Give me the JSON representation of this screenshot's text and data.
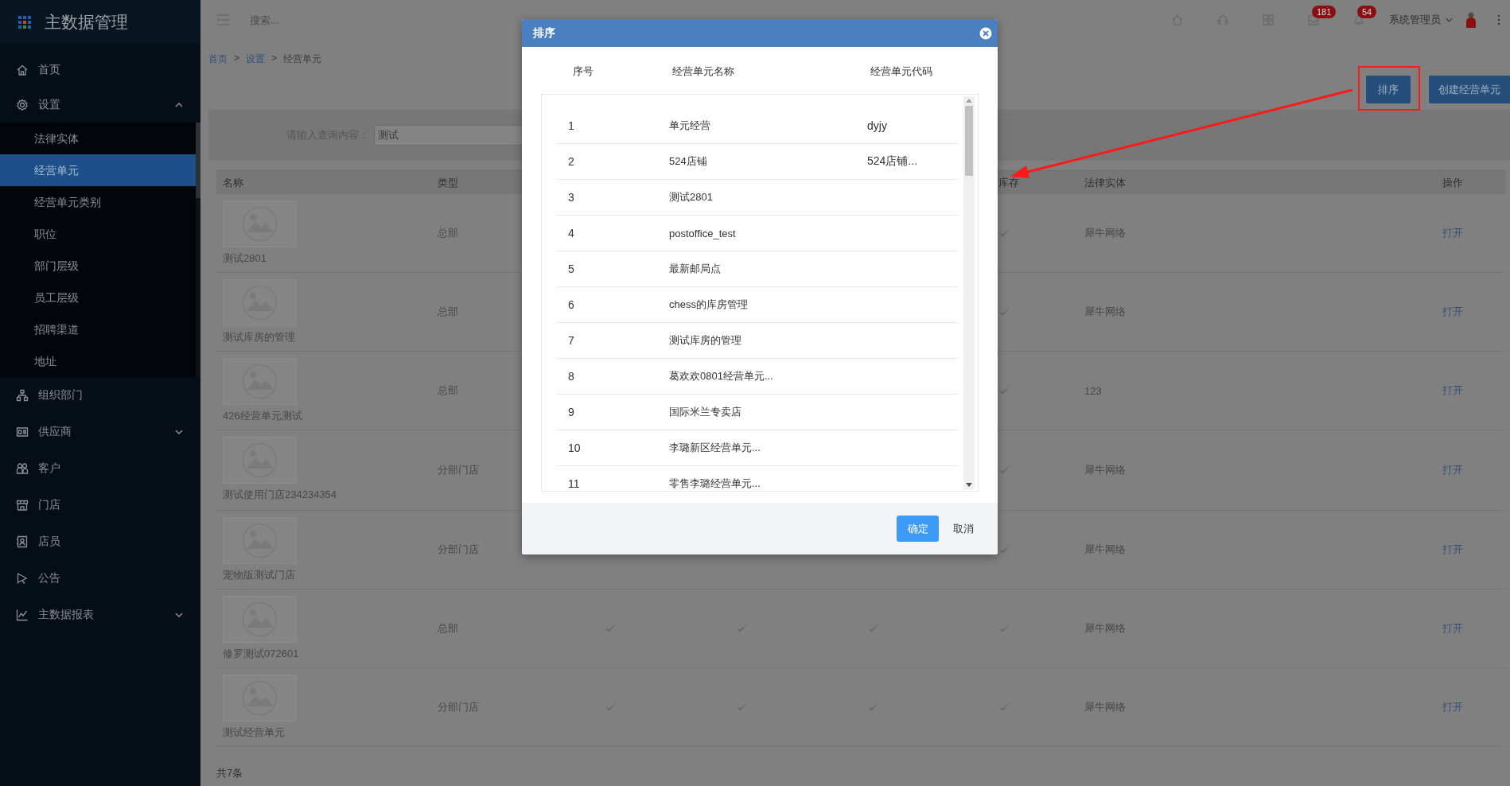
{
  "sidebar": {
    "title": "主数据管理",
    "items": [
      {
        "label": "首页"
      },
      {
        "label": "设置",
        "expanded": true,
        "children": [
          {
            "label": "法律实体",
            "selected": false
          },
          {
            "label": "经营单元",
            "selected": true
          },
          {
            "label": "经营单元类别",
            "selected": false
          },
          {
            "label": "职位",
            "selected": false
          },
          {
            "label": "部门层级",
            "selected": false
          },
          {
            "label": "员工层级",
            "selected": false
          },
          {
            "label": "招聘渠道",
            "selected": false
          },
          {
            "label": "地址",
            "selected": false
          }
        ]
      },
      {
        "label": "组织部门"
      },
      {
        "label": "供应商",
        "expanded": false
      },
      {
        "label": "客户"
      },
      {
        "label": "门店"
      },
      {
        "label": "店员"
      },
      {
        "label": "公告"
      },
      {
        "label": "主数据报表",
        "expanded": false
      }
    ]
  },
  "topbar": {
    "search": {
      "placeholder": "搜索..."
    },
    "badges": [
      {
        "count": "181"
      },
      {
        "count": "54"
      }
    ],
    "user": "系统管理员"
  },
  "breadcrumb": {
    "items": [
      "首页",
      "设置",
      "经营单元"
    ],
    "separator": ">"
  },
  "actions": [
    "排序",
    "创建经营单元"
  ],
  "filter": {
    "label": "请输入查询内容：",
    "value": "测试"
  },
  "table": {
    "columns": [
      "名称",
      "类型",
      "库存",
      "法律实体",
      "操作"
    ],
    "rows": [
      {
        "name": "测试2801",
        "type": "总部",
        "stock": true,
        "entity": "犀牛网络",
        "action": "打开"
      },
      {
        "name": "测试库房的管理",
        "type": "总部",
        "stock": true,
        "entity": "犀牛网络",
        "action": "打开"
      },
      {
        "name": "426经营单元测试",
        "type": "总部",
        "stock": true,
        "entity": "123",
        "action": "打开"
      },
      {
        "name": "测试使用门店234234354",
        "type": "分部门店",
        "stock": true,
        "entity": "犀牛网络",
        "action": "打开"
      },
      {
        "name": "宠物版测试门店",
        "type": "分部门店",
        "stock": true,
        "entity": "犀牛网络",
        "action": "打开"
      },
      {
        "name": "修罗测试072601",
        "type": "总部",
        "checks": [
          true,
          true,
          true
        ],
        "stock": true,
        "entity": "犀牛网络",
        "action": "打开"
      },
      {
        "name": "测试经营单元",
        "type": "分部门店",
        "checks": [
          true,
          true,
          true
        ],
        "stock": true,
        "entity": "犀牛网络",
        "action": "打开"
      }
    ],
    "total": "共7条"
  },
  "modal": {
    "title": "排序",
    "columns": [
      "序号",
      "经营单元名称",
      "经营单元代码"
    ],
    "rows": [
      {
        "no": "1",
        "name": "单元经营",
        "code": "dyjy"
      },
      {
        "no": "2",
        "name": "524店铺",
        "code": "524店铺..."
      },
      {
        "no": "3",
        "name": "测试2801"
      },
      {
        "no": "4",
        "name": "postoffice_test"
      },
      {
        "no": "5",
        "name": "最新邮局点"
      },
      {
        "no": "6",
        "name": "chess的库房管理"
      },
      {
        "no": "7",
        "name": "测试库房的管理"
      },
      {
        "no": "8",
        "name": "葛欢欢0801经营单元..."
      },
      {
        "no": "9",
        "name": "国际米兰专卖店"
      },
      {
        "no": "10",
        "name": "李璐新区经营单元..."
      },
      {
        "no": "11",
        "name": "零售李璐经营单元..."
      }
    ],
    "buttons": [
      {
        "label": "确定",
        "primary": true
      },
      {
        "label": "取消",
        "primary": false
      }
    ]
  }
}
